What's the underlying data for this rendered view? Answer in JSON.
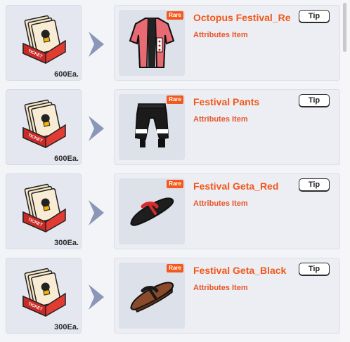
{
  "rows": [
    {
      "cost_qty": "600Ea.",
      "rarity": "Rare",
      "name": "Octopus Festival_Re",
      "type": "Attributes Item",
      "tip_label": "Tip",
      "item_icon": "festival-coat-icon"
    },
    {
      "cost_qty": "600Ea.",
      "rarity": "Rare",
      "name": "Festival Pants",
      "type": "Attributes Item",
      "tip_label": "Tip",
      "item_icon": "festival-pants-icon"
    },
    {
      "cost_qty": "300Ea.",
      "rarity": "Rare",
      "name": "Festival Geta_Red",
      "type": "Attributes Item",
      "tip_label": "Tip",
      "item_icon": "geta-red-icon"
    },
    {
      "cost_qty": "300Ea.",
      "rarity": "Rare",
      "name": "Festival Geta_Black",
      "type": "Attributes Item",
      "tip_label": "Tip",
      "item_icon": "geta-black-icon"
    }
  ],
  "colors": {
    "accent": "#f2571b",
    "rare_badge": "#f25a1d",
    "tile_bg": "#e4e7ef",
    "arrow": "#8b97b8"
  },
  "icons": {
    "cost": "ticket-box-icon",
    "arrow": "arrow-right-icon"
  }
}
